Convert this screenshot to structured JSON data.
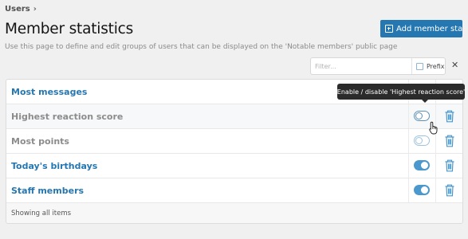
{
  "breadcrumb": {
    "label": "Users",
    "separator": "›"
  },
  "page": {
    "title": "Member statistics",
    "description": "Use this page to define and edit groups of users that can be displayed on the 'Notable members' public page"
  },
  "toolbar": {
    "add_button_label": "Add member stat",
    "add_button_icon": "plus-square-icon"
  },
  "filter": {
    "placeholder": "Filter...",
    "value": "",
    "prefix_label": "Prefix",
    "prefix_checked": false,
    "clear_icon": "close-icon"
  },
  "rows": [
    {
      "label": "Most messages",
      "enabled": true
    },
    {
      "label": "Highest reaction score",
      "enabled": false
    },
    {
      "label": "Most points",
      "enabled": false
    },
    {
      "label": "Today's birthdays",
      "enabled": true
    },
    {
      "label": "Staff members",
      "enabled": true
    }
  ],
  "row_actions": {
    "toggle_icon": "toggle-switch-icon",
    "delete_icon": "trash-icon"
  },
  "footer": {
    "text": "Showing all items"
  },
  "tooltip": {
    "text": "Enable / disable 'Highest reaction score'"
  },
  "colors": {
    "accent": "#2577b1",
    "toggle_on": "#4b98cc",
    "tooltip_bg": "#2b2b2b",
    "page_bg": "#f0f0f1"
  }
}
